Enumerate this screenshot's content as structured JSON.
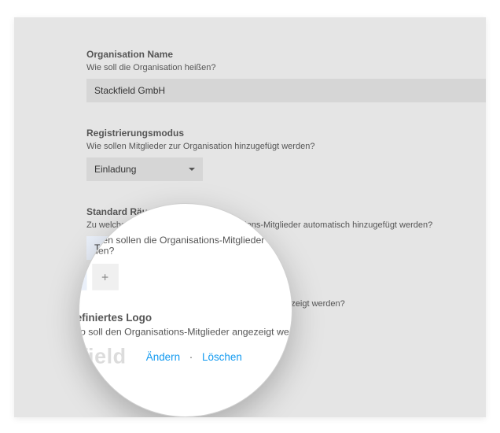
{
  "org_name": {
    "label": "Organisation Name",
    "hint": "Wie soll die Organisation heißen?",
    "value": "Stackfield GmbH"
  },
  "reg_mode": {
    "label": "Registrierungsmodus",
    "hint": "Wie sollen Mitglieder zur Organisation hinzugefügt werden?",
    "selected": "Einladung"
  },
  "rooms": {
    "label": "Standard Räume",
    "hint": "Zu welchen Räumen sollen die Organisations-Mitglieder automatisch hinzugefügt werden?",
    "chips": [
      "Tutorial"
    ]
  },
  "logo": {
    "label": "Benutzerdefiniertes Logo",
    "hint": "Welches Logo soll den Organisations-Mitglieder angezeigt werden?",
    "word": "stackfield",
    "change": "Ändern",
    "delete": "Löschen"
  }
}
